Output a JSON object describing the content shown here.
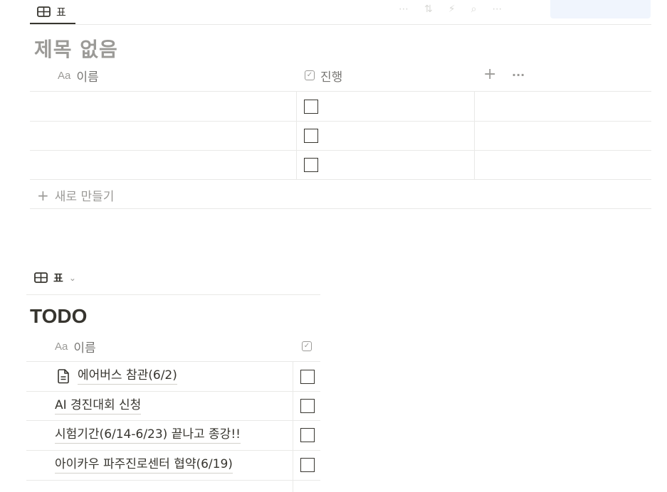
{
  "view_tab_1": {
    "icon": "table-icon",
    "label": "표"
  },
  "database_1": {
    "title": "제목 없음",
    "columns": [
      {
        "type_icon": "Aa",
        "name": "이름"
      },
      {
        "type_icon": "checkbox-icon",
        "name": "진행"
      }
    ],
    "header_actions": {
      "add": "+",
      "more": "···"
    },
    "rows": [
      {
        "name": "",
        "done": false
      },
      {
        "name": "",
        "done": false
      },
      {
        "name": "",
        "done": false
      }
    ],
    "new_row_label": "새로 만들기"
  },
  "view_tab_2": {
    "icon": "table-icon",
    "label": "표"
  },
  "database_2": {
    "title": "TODO",
    "columns": [
      {
        "type_icon": "Aa",
        "name": "이름"
      },
      {
        "type_icon": "checkbox-icon",
        "name": ""
      }
    ],
    "rows": [
      {
        "name": "에어버스 참관(6/2)",
        "icon": "page-icon",
        "done": false
      },
      {
        "name": "AI 경진대회 신청",
        "done": false
      },
      {
        "name": "시험기간(6/14-6/23) 끝나고 종강!!",
        "done": false
      },
      {
        "name": "아이카우 파주진로센터 협약(6/19)",
        "done": false
      }
    ]
  },
  "colors": {
    "text": "#37352f",
    "muted": "#9b9a97",
    "border": "#e9e9e7",
    "accent": "#2383e2"
  }
}
